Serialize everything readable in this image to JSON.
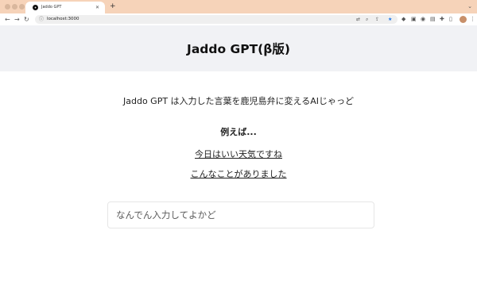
{
  "browser": {
    "tab_title": "Jaddo GPT",
    "new_tab": "+",
    "url": "localhost:3000"
  },
  "page": {
    "header_title": "Jaddo GPT(β版)",
    "description": "Jaddo GPT は入力した言葉を鹿児島弁に変えるAIじゃっど",
    "examples_label": "例えば...",
    "examples": [
      "今日はいい天気ですね",
      "こんなことがありました"
    ],
    "input_placeholder": "なんでん入力してよかど",
    "input_value": ""
  },
  "colors": {
    "tabbar": "#f6d3b9",
    "header_bg": "#f1f2f5",
    "page_bg": "#ffffff"
  }
}
